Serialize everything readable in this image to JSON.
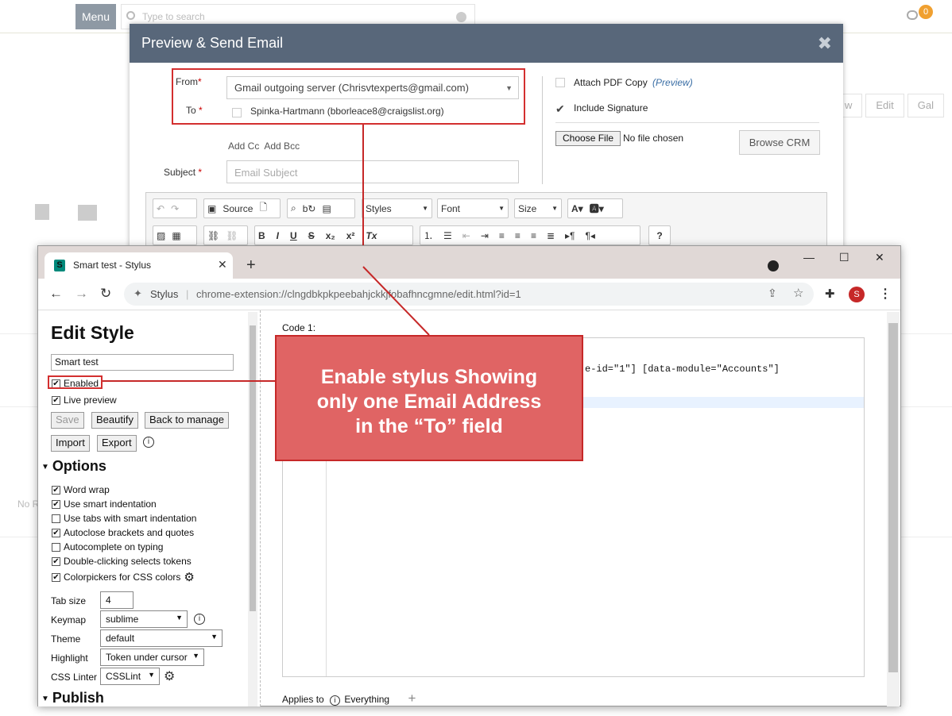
{
  "app_header": {
    "menu_label": "Menu",
    "search_placeholder": "Type to search",
    "notification_count": "0",
    "right_buttons": [
      "w",
      "Edit",
      "Gal"
    ],
    "empty_text": "No R"
  },
  "modal": {
    "title": "Preview & Send Email",
    "close_icon": "close-icon",
    "from_label": "From",
    "from_value": "Gmail outgoing server (Chrisvtexperts@gmail.com)",
    "to_label": "To",
    "to_value": "Spinka-Hartmann (bborleace8@craigslist.org)",
    "add_cc": "Add Cc",
    "add_bcc": "Add Bcc",
    "subject_label": "Subject",
    "subject_placeholder": "Email Subject",
    "attach_pdf_label": "Attach PDF Copy",
    "preview_link": "(Preview)",
    "include_signature_label": "Include Signature",
    "choose_file_label": "Choose File",
    "no_file_label": "No file chosen",
    "browse_crm_label": "Browse CRM",
    "toolbar": {
      "source_label": "Source",
      "styles_label": "Styles",
      "font_label": "Font",
      "size_label": "Size"
    }
  },
  "browser": {
    "tab_title": "Smart test - Stylus",
    "omnibox_label": "Stylus",
    "url": "chrome-extension://clngdbkpkpeebahjckkjfobafhncgmne/edit.html?id=1",
    "avatar_letter": "S"
  },
  "stylus": {
    "title": "Edit Style",
    "style_name": "Smart test",
    "enabled_label": "Enabled",
    "live_preview_label": "Live preview",
    "save_label": "Save",
    "beautify_label": "Beautify",
    "back_label": "Back to manage",
    "import_label": "Import",
    "export_label": "Export",
    "options_title": "Options",
    "options": [
      {
        "label": "Word wrap",
        "checked": true
      },
      {
        "label": "Use smart indentation",
        "checked": true
      },
      {
        "label": "Use tabs with smart indentation",
        "checked": false
      },
      {
        "label": "Autoclose brackets and quotes",
        "checked": true
      },
      {
        "label": "Autocomplete on typing",
        "checked": false
      },
      {
        "label": "Double-clicking selects tokens",
        "checked": true
      },
      {
        "label": "Colorpickers for CSS colors",
        "checked": true
      }
    ],
    "tab_size_label": "Tab size",
    "tab_size_value": "4",
    "keymap_label": "Keymap",
    "keymap_value": "sublime",
    "theme_label": "Theme",
    "theme_value": "default",
    "highlight_label": "Highlight",
    "highlight_value": "Token under cursor",
    "linter_label": "CSS Linter",
    "linter_value": "CSSLint",
    "publish_title": "Publish",
    "code_label": "Code 1:",
    "code_visible": "e-id=\"1\"] [data-module=\"Accounts\"]",
    "applies_label": "Applies to",
    "applies_value": "Everything"
  },
  "callout": {
    "line1": "Enable stylus Showing",
    "line2": "only one Email Address",
    "line3": "in the “To” field"
  }
}
